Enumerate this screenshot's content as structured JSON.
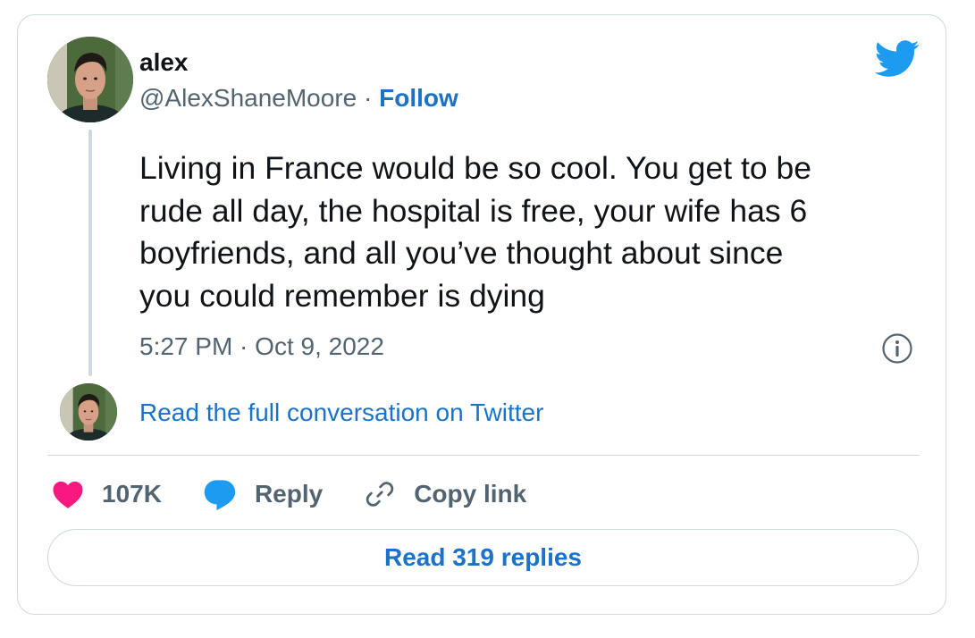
{
  "author": {
    "name": "alex",
    "handle": "@AlexShaneMoore",
    "separator": " · ",
    "follow_label": "Follow"
  },
  "tweet": {
    "lines": [
      "Living in France would be so cool. You get to be",
      "rude all day, the hospital is free, your wife has 6",
      "boyfriends, and all you’ve thought about since",
      "you could remember is dying"
    ],
    "timestamp": "5:27 PM · Oct 9, 2022"
  },
  "conversation_link": "Read the full conversation on Twitter",
  "actions": {
    "likes": "107K",
    "reply": "Reply",
    "copy_link": "Copy link"
  },
  "read_replies": "Read 319 replies",
  "icons": {
    "brand": "twitter-bird-icon",
    "info": "info-icon",
    "like": "heart-icon",
    "reply": "speech-bubble-icon",
    "copy": "link-icon"
  },
  "colors": {
    "twitter_blue": "#1d9bf0",
    "link_blue": "#1a73c9",
    "like_pink": "#f91880",
    "muted_text": "#536471",
    "border": "#cfd9de"
  }
}
